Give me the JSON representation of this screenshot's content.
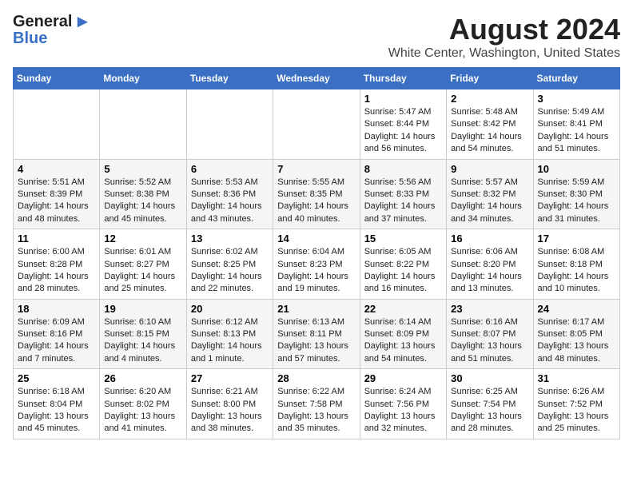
{
  "header": {
    "logo_general": "General",
    "logo_blue": "Blue",
    "main_title": "August 2024",
    "subtitle": "White Center, Washington, United States"
  },
  "calendar": {
    "headers": [
      "Sunday",
      "Monday",
      "Tuesday",
      "Wednesday",
      "Thursday",
      "Friday",
      "Saturday"
    ],
    "weeks": [
      [
        {
          "day": "",
          "detail": ""
        },
        {
          "day": "",
          "detail": ""
        },
        {
          "day": "",
          "detail": ""
        },
        {
          "day": "",
          "detail": ""
        },
        {
          "day": "1",
          "detail": "Sunrise: 5:47 AM\nSunset: 8:44 PM\nDaylight: 14 hours\nand 56 minutes."
        },
        {
          "day": "2",
          "detail": "Sunrise: 5:48 AM\nSunset: 8:42 PM\nDaylight: 14 hours\nand 54 minutes."
        },
        {
          "day": "3",
          "detail": "Sunrise: 5:49 AM\nSunset: 8:41 PM\nDaylight: 14 hours\nand 51 minutes."
        }
      ],
      [
        {
          "day": "4",
          "detail": "Sunrise: 5:51 AM\nSunset: 8:39 PM\nDaylight: 14 hours\nand 48 minutes."
        },
        {
          "day": "5",
          "detail": "Sunrise: 5:52 AM\nSunset: 8:38 PM\nDaylight: 14 hours\nand 45 minutes."
        },
        {
          "day": "6",
          "detail": "Sunrise: 5:53 AM\nSunset: 8:36 PM\nDaylight: 14 hours\nand 43 minutes."
        },
        {
          "day": "7",
          "detail": "Sunrise: 5:55 AM\nSunset: 8:35 PM\nDaylight: 14 hours\nand 40 minutes."
        },
        {
          "day": "8",
          "detail": "Sunrise: 5:56 AM\nSunset: 8:33 PM\nDaylight: 14 hours\nand 37 minutes."
        },
        {
          "day": "9",
          "detail": "Sunrise: 5:57 AM\nSunset: 8:32 PM\nDaylight: 14 hours\nand 34 minutes."
        },
        {
          "day": "10",
          "detail": "Sunrise: 5:59 AM\nSunset: 8:30 PM\nDaylight: 14 hours\nand 31 minutes."
        }
      ],
      [
        {
          "day": "11",
          "detail": "Sunrise: 6:00 AM\nSunset: 8:28 PM\nDaylight: 14 hours\nand 28 minutes."
        },
        {
          "day": "12",
          "detail": "Sunrise: 6:01 AM\nSunset: 8:27 PM\nDaylight: 14 hours\nand 25 minutes."
        },
        {
          "day": "13",
          "detail": "Sunrise: 6:02 AM\nSunset: 8:25 PM\nDaylight: 14 hours\nand 22 minutes."
        },
        {
          "day": "14",
          "detail": "Sunrise: 6:04 AM\nSunset: 8:23 PM\nDaylight: 14 hours\nand 19 minutes."
        },
        {
          "day": "15",
          "detail": "Sunrise: 6:05 AM\nSunset: 8:22 PM\nDaylight: 14 hours\nand 16 minutes."
        },
        {
          "day": "16",
          "detail": "Sunrise: 6:06 AM\nSunset: 8:20 PM\nDaylight: 14 hours\nand 13 minutes."
        },
        {
          "day": "17",
          "detail": "Sunrise: 6:08 AM\nSunset: 8:18 PM\nDaylight: 14 hours\nand 10 minutes."
        }
      ],
      [
        {
          "day": "18",
          "detail": "Sunrise: 6:09 AM\nSunset: 8:16 PM\nDaylight: 14 hours\nand 7 minutes."
        },
        {
          "day": "19",
          "detail": "Sunrise: 6:10 AM\nSunset: 8:15 PM\nDaylight: 14 hours\nand 4 minutes."
        },
        {
          "day": "20",
          "detail": "Sunrise: 6:12 AM\nSunset: 8:13 PM\nDaylight: 14 hours\nand 1 minute."
        },
        {
          "day": "21",
          "detail": "Sunrise: 6:13 AM\nSunset: 8:11 PM\nDaylight: 13 hours\nand 57 minutes."
        },
        {
          "day": "22",
          "detail": "Sunrise: 6:14 AM\nSunset: 8:09 PM\nDaylight: 13 hours\nand 54 minutes."
        },
        {
          "day": "23",
          "detail": "Sunrise: 6:16 AM\nSunset: 8:07 PM\nDaylight: 13 hours\nand 51 minutes."
        },
        {
          "day": "24",
          "detail": "Sunrise: 6:17 AM\nSunset: 8:05 PM\nDaylight: 13 hours\nand 48 minutes."
        }
      ],
      [
        {
          "day": "25",
          "detail": "Sunrise: 6:18 AM\nSunset: 8:04 PM\nDaylight: 13 hours\nand 45 minutes."
        },
        {
          "day": "26",
          "detail": "Sunrise: 6:20 AM\nSunset: 8:02 PM\nDaylight: 13 hours\nand 41 minutes."
        },
        {
          "day": "27",
          "detail": "Sunrise: 6:21 AM\nSunset: 8:00 PM\nDaylight: 13 hours\nand 38 minutes."
        },
        {
          "day": "28",
          "detail": "Sunrise: 6:22 AM\nSunset: 7:58 PM\nDaylight: 13 hours\nand 35 minutes."
        },
        {
          "day": "29",
          "detail": "Sunrise: 6:24 AM\nSunset: 7:56 PM\nDaylight: 13 hours\nand 32 minutes."
        },
        {
          "day": "30",
          "detail": "Sunrise: 6:25 AM\nSunset: 7:54 PM\nDaylight: 13 hours\nand 28 minutes."
        },
        {
          "day": "31",
          "detail": "Sunrise: 6:26 AM\nSunset: 7:52 PM\nDaylight: 13 hours\nand 25 minutes."
        }
      ]
    ]
  }
}
